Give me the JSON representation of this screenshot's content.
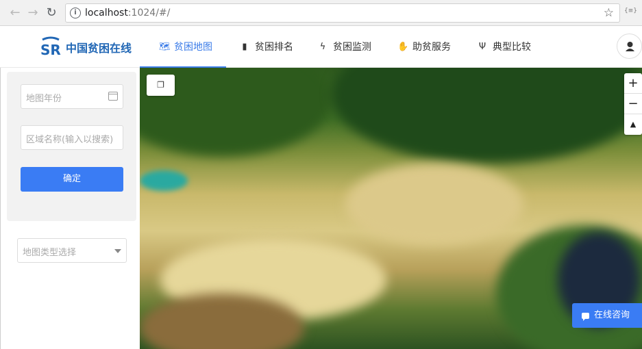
{
  "browser": {
    "url_host": "localhost",
    "url_path": ":1024/#/"
  },
  "app": {
    "logo_text": "中国贫困在线",
    "nav": [
      {
        "label": "贫困地图",
        "icon": "map-icon"
      },
      {
        "label": "贫困排名",
        "icon": "bar-chart-icon"
      },
      {
        "label": "贫困监测",
        "icon": "bolt-icon"
      },
      {
        "label": "助贫服务",
        "icon": "hand-icon"
      },
      {
        "label": "典型比较",
        "icon": "fork-icon"
      }
    ],
    "active_nav": "贫困地图"
  },
  "sidebar": {
    "year_placeholder": "地图年份",
    "region_placeholder": "区域名称(输入以搜索)",
    "confirm_label": "确定",
    "map_type_placeholder": "地图类型选择"
  },
  "map": {
    "zoom_in": "+",
    "zoom_out": "−",
    "compass": "▲",
    "chat_label": "在线咨询"
  },
  "colors": {
    "accent": "#3a7cf4",
    "brand": "#2167b5"
  }
}
